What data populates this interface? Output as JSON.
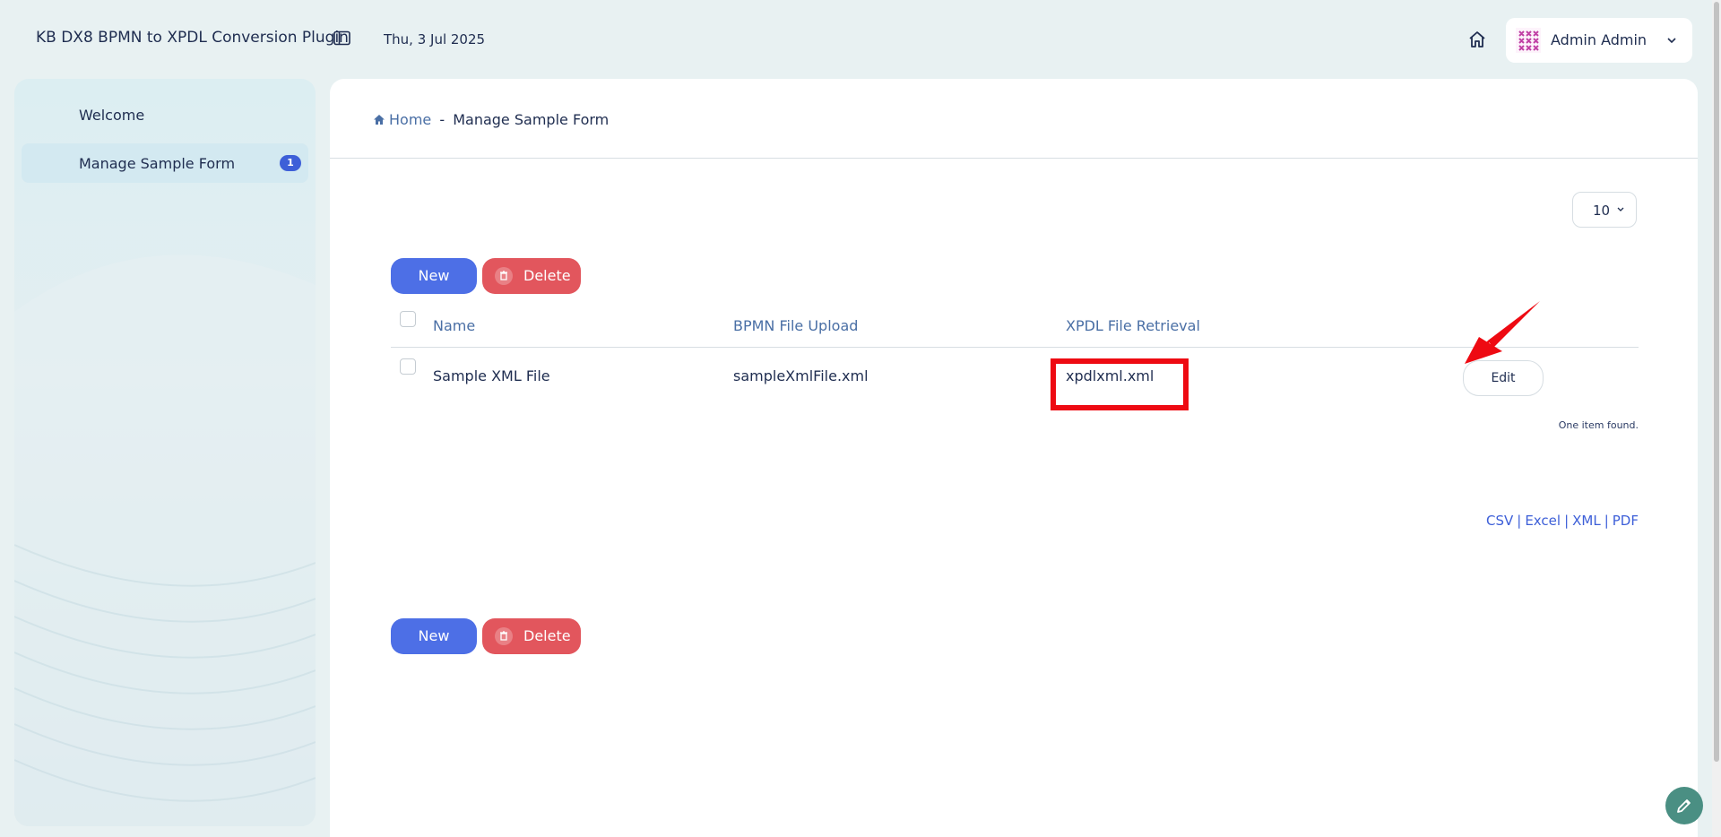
{
  "header": {
    "app_title": "KB DX8 BPMN to XPDL Conversion Plugin",
    "date": "Thu, 3 Jul 2025",
    "user_name": "Admin Admin"
  },
  "sidebar": {
    "items": [
      {
        "label": "Welcome"
      },
      {
        "label": "Manage Sample Form",
        "badge": "1",
        "active": true
      }
    ]
  },
  "breadcrumb": {
    "home": "Home",
    "separator": "-",
    "current": "Manage Sample Form"
  },
  "list": {
    "page_size": "10",
    "new_label": "New",
    "delete_label": "Delete",
    "columns": [
      "Name",
      "BPMN File Upload",
      "XPDL File Retrieval"
    ],
    "rows": [
      {
        "name": "Sample XML File",
        "bpmn_file": "sampleXmlFile.xml",
        "xpdl_file": "xpdlxml.xml",
        "action": "Edit"
      }
    ],
    "found_text": "One item found.",
    "exports": [
      "CSV",
      "Excel",
      "XML",
      "PDF"
    ],
    "export_separator": "|"
  },
  "colors": {
    "primary": "#4d6fe6",
    "danger": "#e2565d",
    "highlight": "#ee0a12",
    "accent_teal": "#4a8f83"
  },
  "icons": [
    "sidebar-toggle-icon",
    "home-icon",
    "chevron-down-icon",
    "trash-icon",
    "pencil-icon",
    "arrow-annotation-icon"
  ]
}
